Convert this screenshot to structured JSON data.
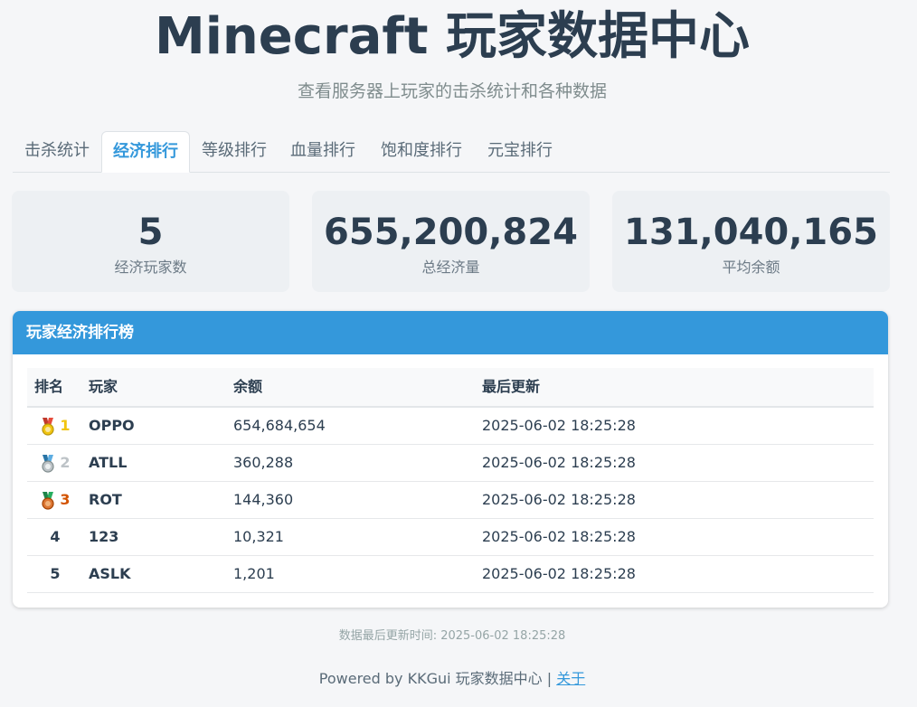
{
  "header": {
    "title": "Minecraft 玩家数据中心",
    "subtitle": "查看服务器上玩家的击杀统计和各种数据"
  },
  "tabs": [
    {
      "label": "击杀统计",
      "active": false
    },
    {
      "label": "经济排行",
      "active": true
    },
    {
      "label": "等级排行",
      "active": false
    },
    {
      "label": "血量排行",
      "active": false
    },
    {
      "label": "饱和度排行",
      "active": false
    },
    {
      "label": "元宝排行",
      "active": false
    }
  ],
  "stats": [
    {
      "value": "5",
      "label": "经济玩家数"
    },
    {
      "value": "655,200,824",
      "label": "总经济量"
    },
    {
      "value": "131,040,165",
      "label": "平均余额"
    }
  ],
  "ranking": {
    "title": "玩家经济排行榜",
    "columns": [
      "排名",
      "玩家",
      "余额",
      "最后更新"
    ],
    "rows": [
      {
        "rank": "1",
        "medal": "gold",
        "player": "OPPO",
        "balance": "654,684,654",
        "updated": "2025-06-02 18:25:28"
      },
      {
        "rank": "2",
        "medal": "silver",
        "player": "ATLL",
        "balance": "360,288",
        "updated": "2025-06-02 18:25:28"
      },
      {
        "rank": "3",
        "medal": "bronze",
        "player": "ROT",
        "balance": "144,360",
        "updated": "2025-06-02 18:25:28"
      },
      {
        "rank": "4",
        "medal": "",
        "player": "123",
        "balance": "10,321",
        "updated": "2025-06-02 18:25:28"
      },
      {
        "rank": "5",
        "medal": "",
        "player": "ASLK",
        "balance": "1,201",
        "updated": "2025-06-02 18:25:28"
      }
    ]
  },
  "footer": {
    "updated_text": "数据最后更新时间: 2025-06-02 18:25:28",
    "powered_text": "Powered by KKGui 玩家数据中心 | ",
    "about_link": "关于"
  },
  "colors": {
    "accent": "#3498db",
    "title": "#2c3e50",
    "gold": "#f1c40f",
    "silver": "#bdc3c7",
    "bronze": "#d35400"
  }
}
